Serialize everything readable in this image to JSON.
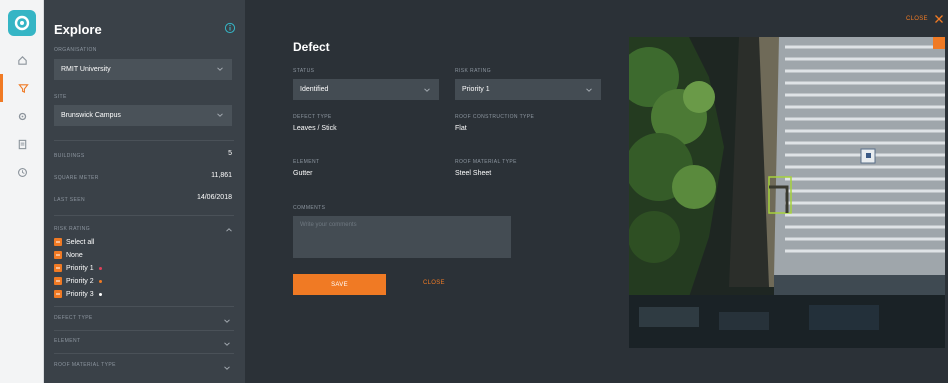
{
  "sidebar": {
    "title": "Explore",
    "organisation": {
      "label": "ORGANISATION",
      "value": "RMIT University"
    },
    "site": {
      "label": "SITE",
      "value": "Brunswick Campus"
    },
    "stats": [
      {
        "label": "BUILDINGS",
        "value": "5"
      },
      {
        "label": "SQUARE METER",
        "value": "11,861"
      },
      {
        "label": "LAST SEEN",
        "value": "14/06/2018"
      }
    ],
    "risk_rating": {
      "label": "RISK RATING",
      "options": [
        {
          "label": "Select all",
          "dot": ""
        },
        {
          "label": "None",
          "dot": ""
        },
        {
          "label": "Priority 1",
          "dot": "#e0405a"
        },
        {
          "label": "Priority 2",
          "dot": "#f07a24"
        },
        {
          "label": "Priority 3",
          "dot": "#ffffff"
        }
      ]
    },
    "collapsed": [
      "DEFECT TYPE",
      "ELEMENT",
      "ROOF MATERIAL TYPE"
    ]
  },
  "rail": {
    "icons": [
      "home-icon",
      "filter-icon",
      "settings-icon",
      "document-icon",
      "clock-icon"
    ]
  },
  "defect": {
    "title": "Defect",
    "status": {
      "label": "STATUS",
      "value": "Identified"
    },
    "risk_rating": {
      "label": "RISK RATING",
      "value": "Priority 1"
    },
    "defect_type": {
      "label": "DEFECT TYPE",
      "value": "Leaves / Stick"
    },
    "roof_construction_type": {
      "label": "ROOF CONSTRUCTION TYPE",
      "value": "Flat"
    },
    "element": {
      "label": "ELEMENT",
      "value": "Gutter"
    },
    "roof_material_type": {
      "label": "ROOF MATERIAL TYPE",
      "value": "Steel Sheet"
    },
    "comments": {
      "label": "COMMENTS",
      "placeholder": "Write your comments"
    },
    "save_label": "SAVE",
    "close_label": "CLOSE"
  },
  "header": {
    "close_label": "CLOSE"
  },
  "colors": {
    "accent": "#f07a24",
    "brand": "#35b5c5",
    "panel": "#3a4148",
    "main": "#2b3137"
  }
}
